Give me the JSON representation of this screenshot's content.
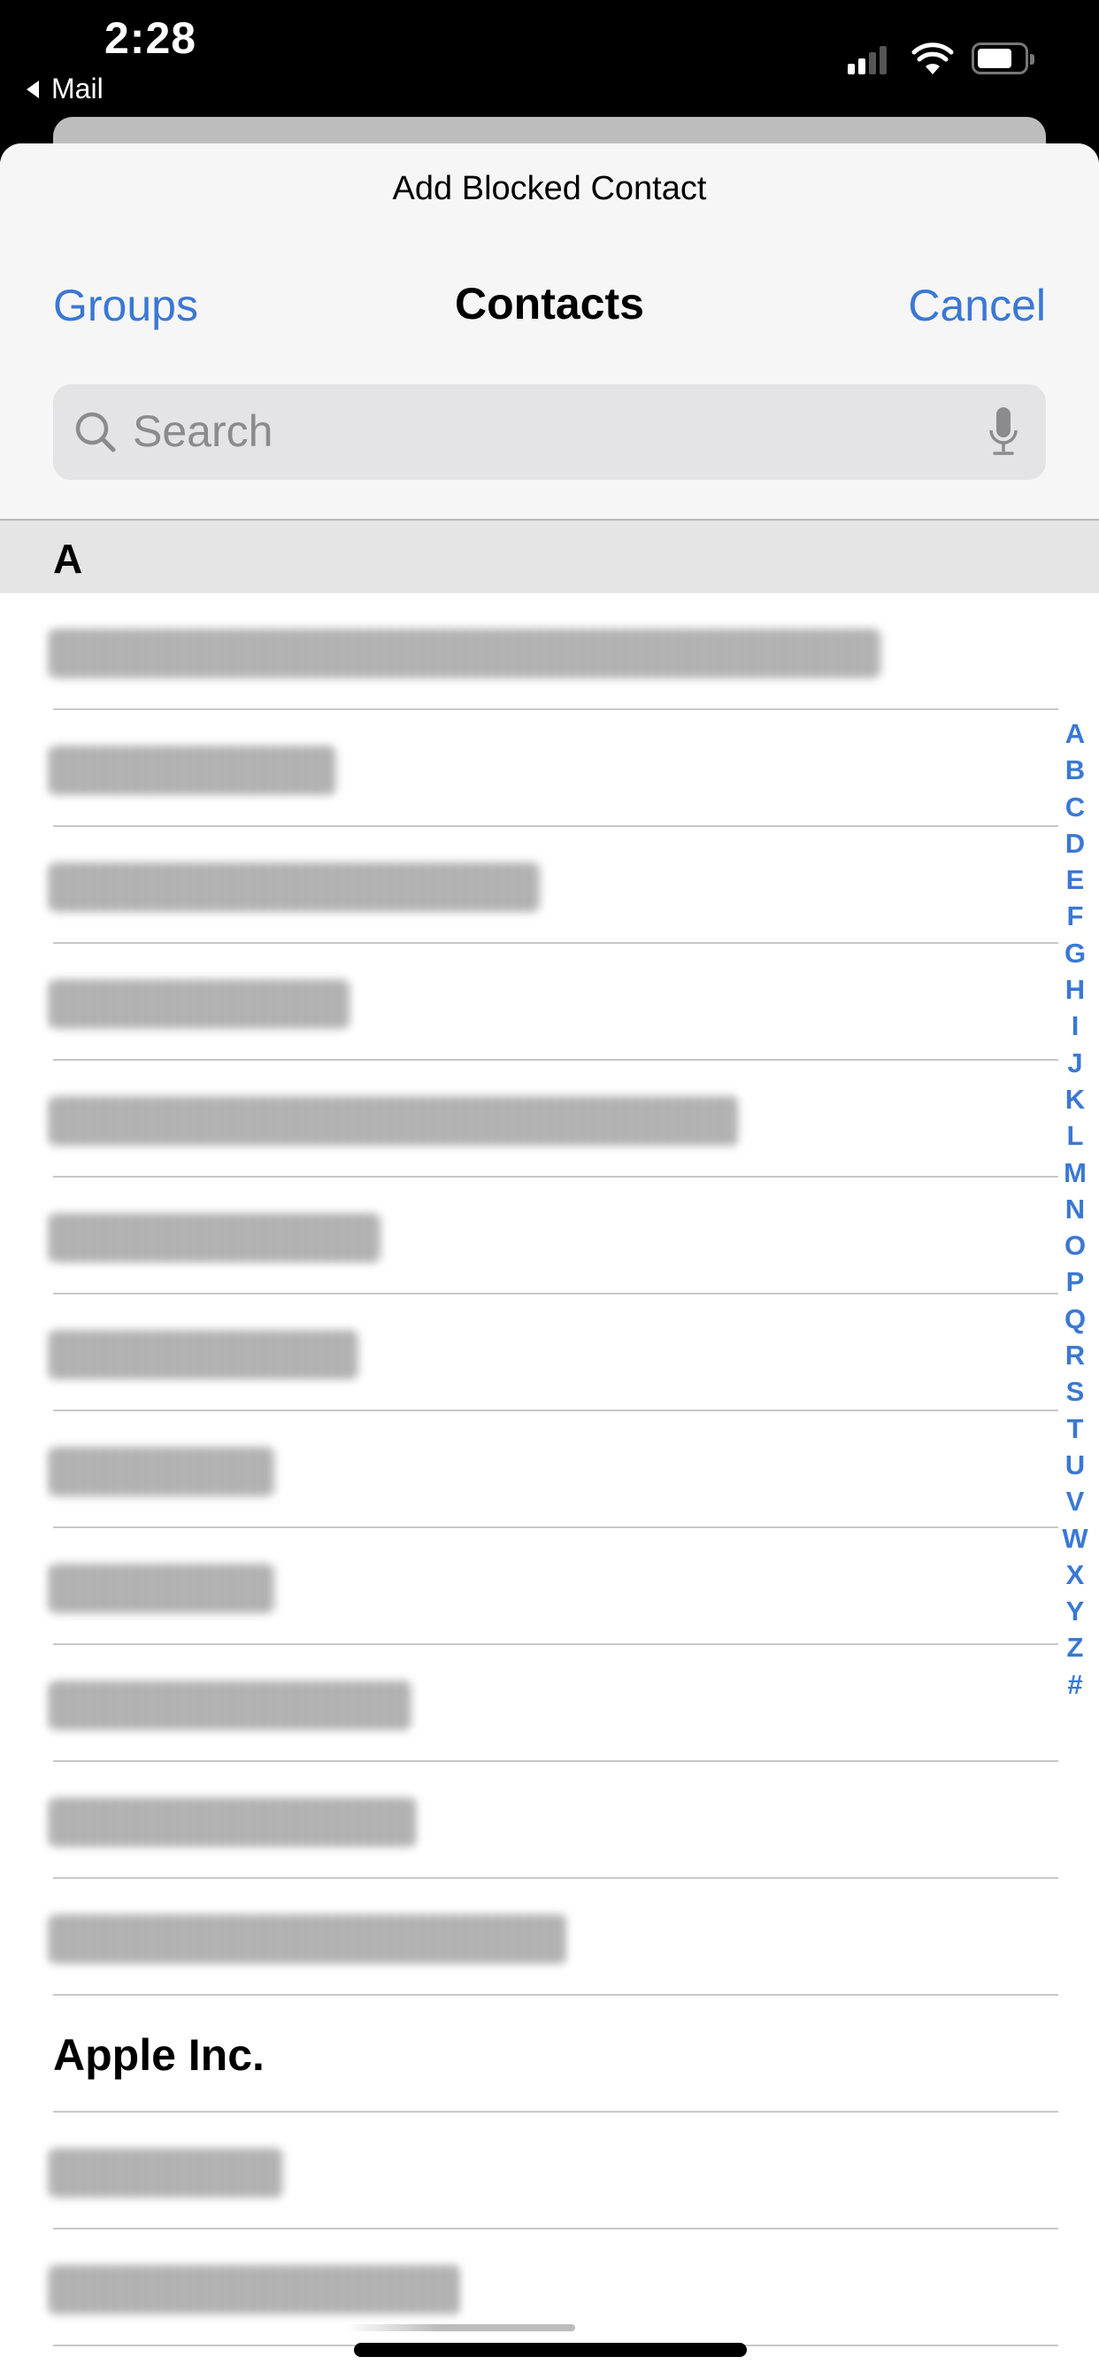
{
  "status_bar": {
    "time": "2:28",
    "back_app": "Mail",
    "signal_bars_active": 2,
    "signal_bars_total": 4,
    "battery_level": 0.6
  },
  "sheet": {
    "prompt": "Add Blocked Contact",
    "nav": {
      "left_label": "Groups",
      "title": "Contacts",
      "right_label": "Cancel"
    },
    "search": {
      "placeholder": "Search"
    }
  },
  "colors": {
    "accent": "#3a78d4",
    "section_bg": "#e5e5e5",
    "header_bg": "#f6f6f6"
  },
  "section": {
    "letter": "A"
  },
  "contacts": [
    {
      "name": "[redacted]",
      "redacted": true
    },
    {
      "name": "[redacted]",
      "redacted": true
    },
    {
      "name": "[redacted]",
      "redacted": true
    },
    {
      "name": "[redacted]",
      "redacted": true
    },
    {
      "name": "[redacted email]",
      "redacted": true
    },
    {
      "name": "[redacted]",
      "redacted": true
    },
    {
      "name": "[redacted]",
      "redacted": true
    },
    {
      "name": "[redacted]",
      "redacted": true
    },
    {
      "name": "[redacted]",
      "redacted": true
    },
    {
      "name": "[redacted]",
      "redacted": true
    },
    {
      "name": "[redacted]",
      "redacted": true
    },
    {
      "name": "[redacted email]",
      "redacted": true
    },
    {
      "name": "Apple Inc.",
      "redacted": false
    },
    {
      "name": "[redacted]",
      "redacted": true
    },
    {
      "name": "[redacted]",
      "redacted": true
    }
  ],
  "index_letters": [
    "A",
    "B",
    "C",
    "D",
    "E",
    "F",
    "G",
    "H",
    "I",
    "J",
    "K",
    "L",
    "M",
    "N",
    "O",
    "P",
    "Q",
    "R",
    "S",
    "T",
    "U",
    "V",
    "W",
    "X",
    "Y",
    "Z",
    "#"
  ]
}
